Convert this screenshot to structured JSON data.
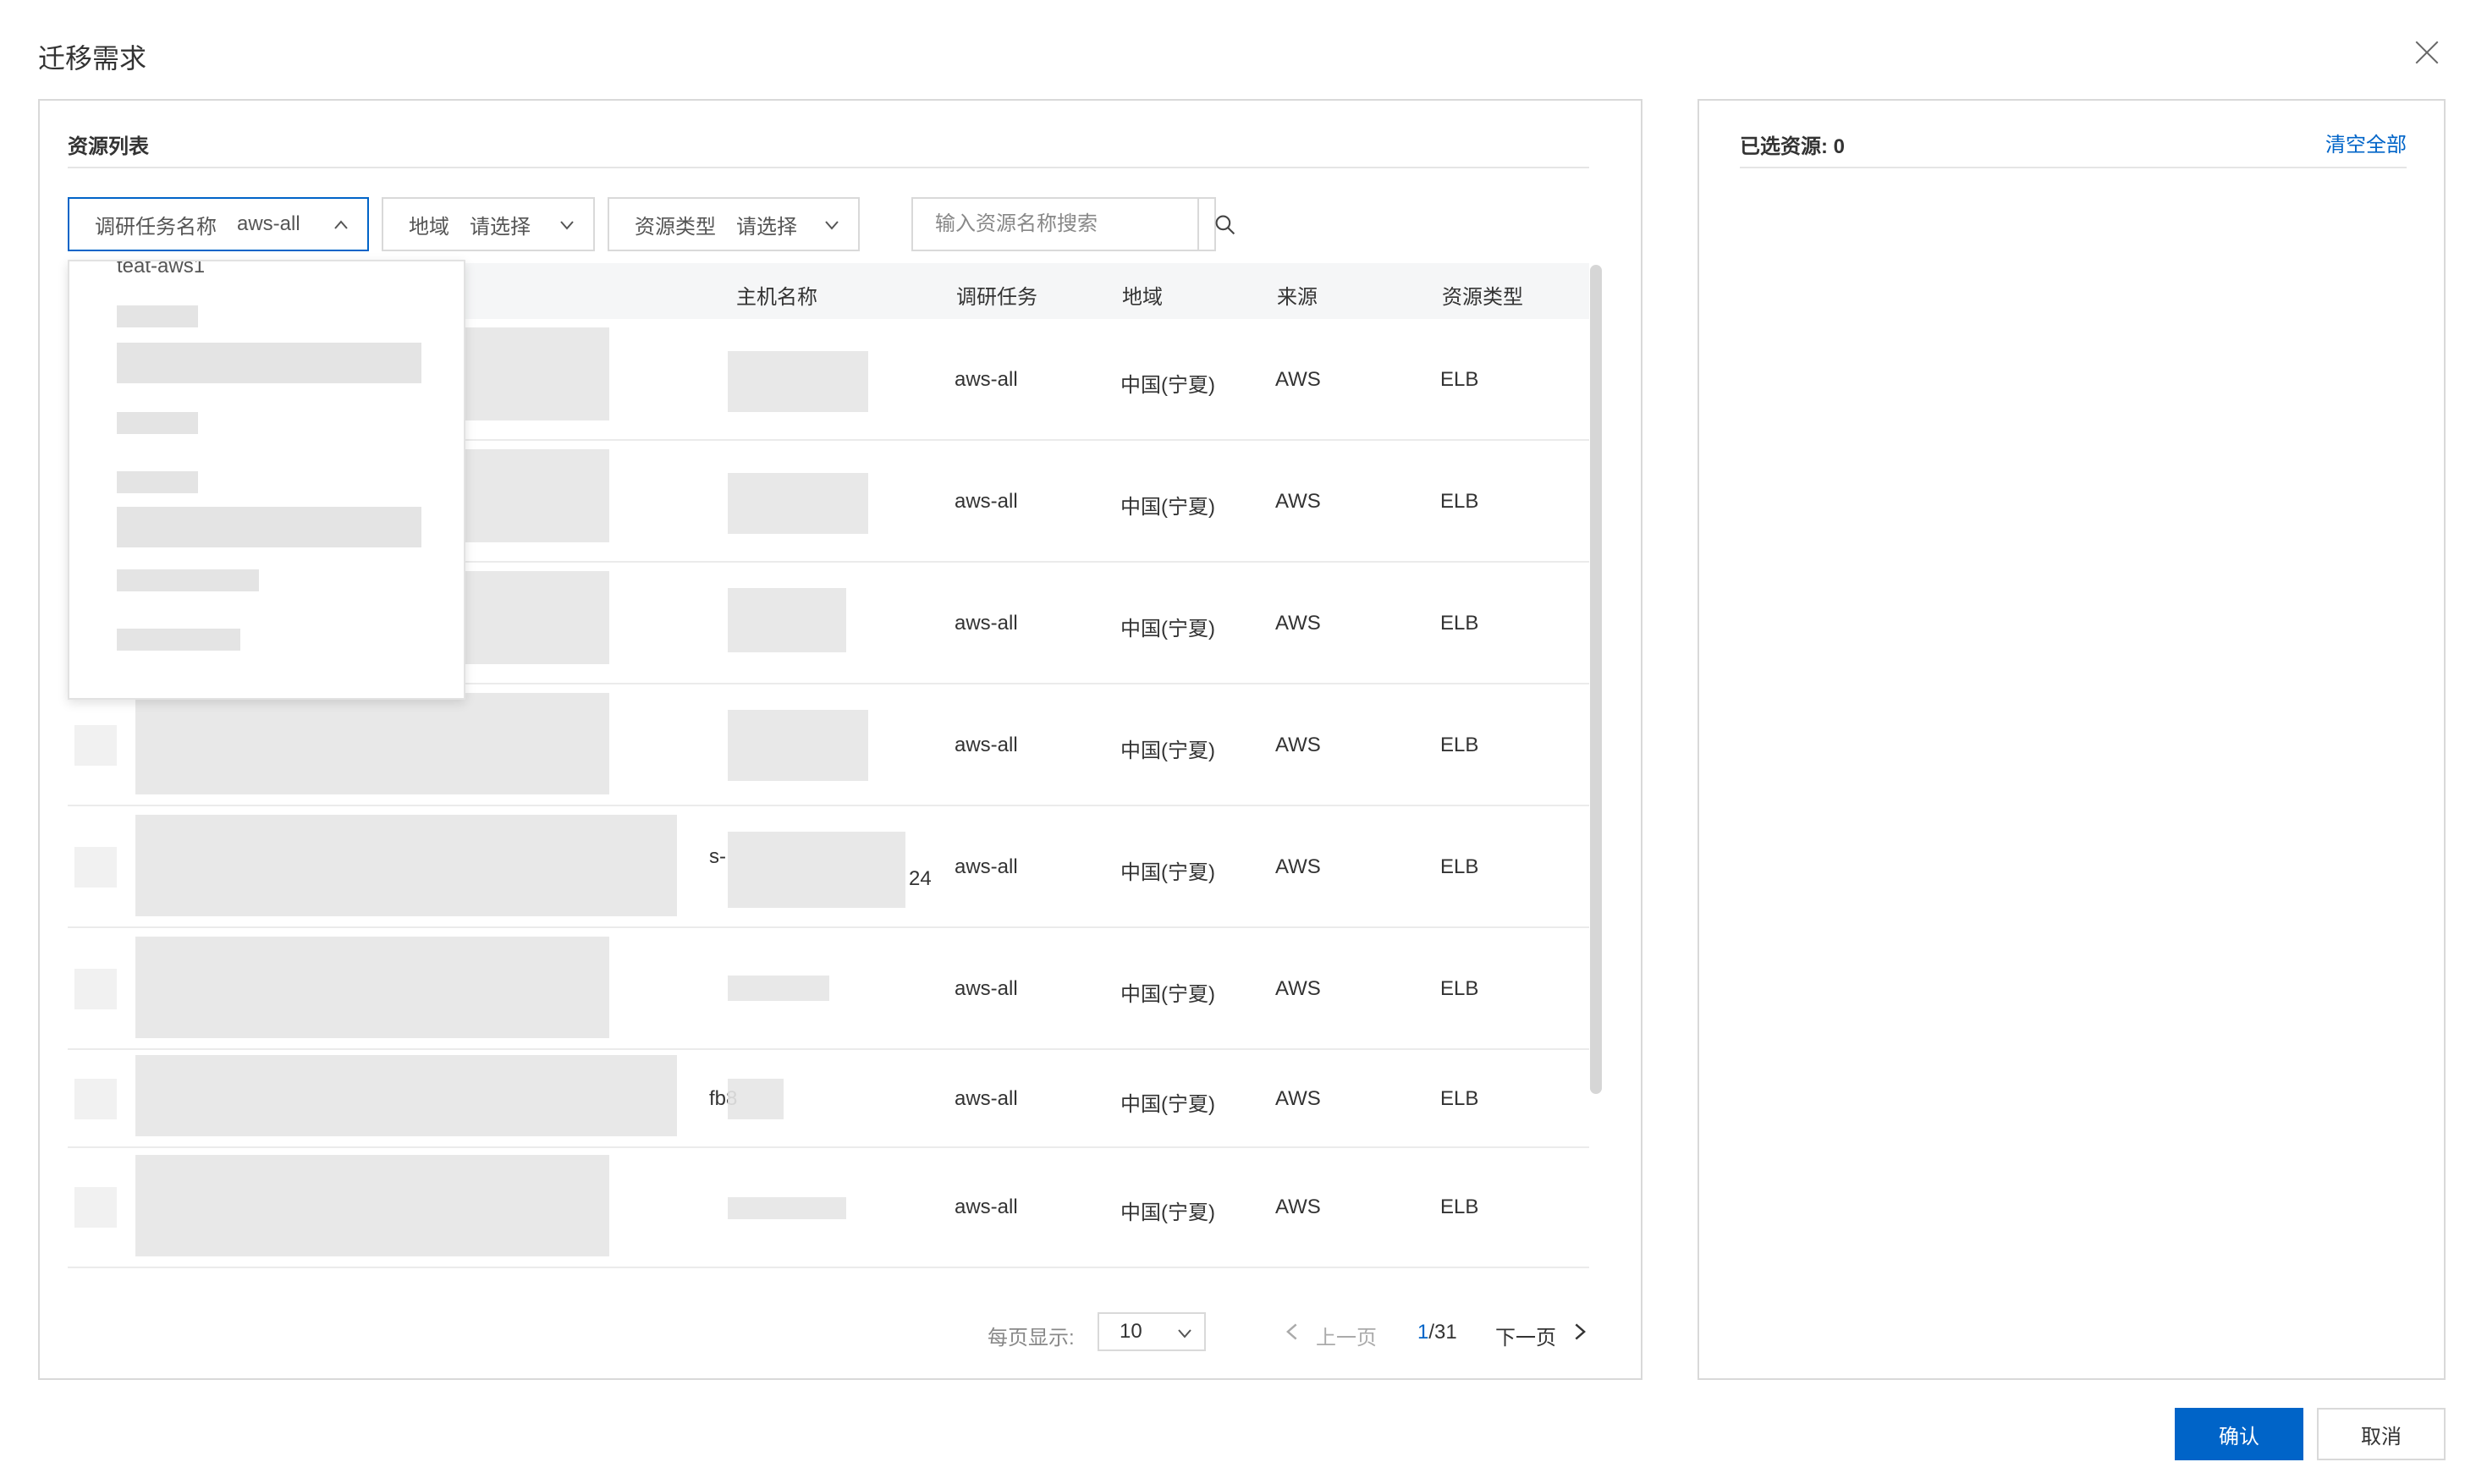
{
  "dialog": {
    "title": "迁移需求"
  },
  "left": {
    "title": "资源列表",
    "filters": {
      "task": {
        "label": "调研任务名称",
        "value": "aws-all"
      },
      "region": {
        "label": "地域",
        "placeholder": "请选择"
      },
      "type": {
        "label": "资源类型",
        "placeholder": "请选择"
      },
      "search": {
        "placeholder": "输入资源名称搜索"
      }
    },
    "dropdown": {
      "visible_option": "teat-aws1"
    },
    "columns": [
      "主机名称",
      "调研任务",
      "地域",
      "来源",
      "资源类型"
    ],
    "rows": [
      {
        "suffix": "",
        "host_suffix": "",
        "task": "aws-all",
        "region": "中国(宁夏)",
        "source": "AWS",
        "type": "ELB"
      },
      {
        "suffix": "",
        "host_suffix": "",
        "task": "aws-all",
        "region": "中国(宁夏)",
        "source": "AWS",
        "type": "ELB"
      },
      {
        "suffix": "",
        "host_suffix": "",
        "task": "aws-all",
        "region": "中国(宁夏)",
        "source": "AWS",
        "type": "ELB"
      },
      {
        "suffix": "",
        "host_suffix": "",
        "task": "aws-all",
        "region": "中国(宁夏)",
        "source": "AWS",
        "type": "ELB"
      },
      {
        "suffix": "s-",
        "host_suffix": "24",
        "task": "aws-all",
        "region": "中国(宁夏)",
        "source": "AWS",
        "type": "ELB"
      },
      {
        "suffix": "",
        "host_suffix": "",
        "task": "aws-all",
        "region": "中国(宁夏)",
        "source": "AWS",
        "type": "ELB"
      },
      {
        "suffix": "fb8",
        "host_suffix": "",
        "task": "aws-all",
        "region": "中国(宁夏)",
        "source": "AWS",
        "type": "ELB"
      },
      {
        "suffix": "",
        "host_suffix": "",
        "task": "aws-all",
        "region": "中国(宁夏)",
        "source": "AWS",
        "type": "ELB"
      }
    ],
    "pagination": {
      "page_size_label": "每页显示:",
      "page_size": "10",
      "prev": "上一页",
      "current": "1",
      "total": "/31",
      "next": "下一页"
    }
  },
  "right": {
    "selected_label": "已选资源: 0",
    "clear_all": "清空全部"
  },
  "footer": {
    "confirm": "确认",
    "cancel": "取消"
  },
  "colors": {
    "primary": "#0064c8",
    "border": "#d9d9d9"
  }
}
